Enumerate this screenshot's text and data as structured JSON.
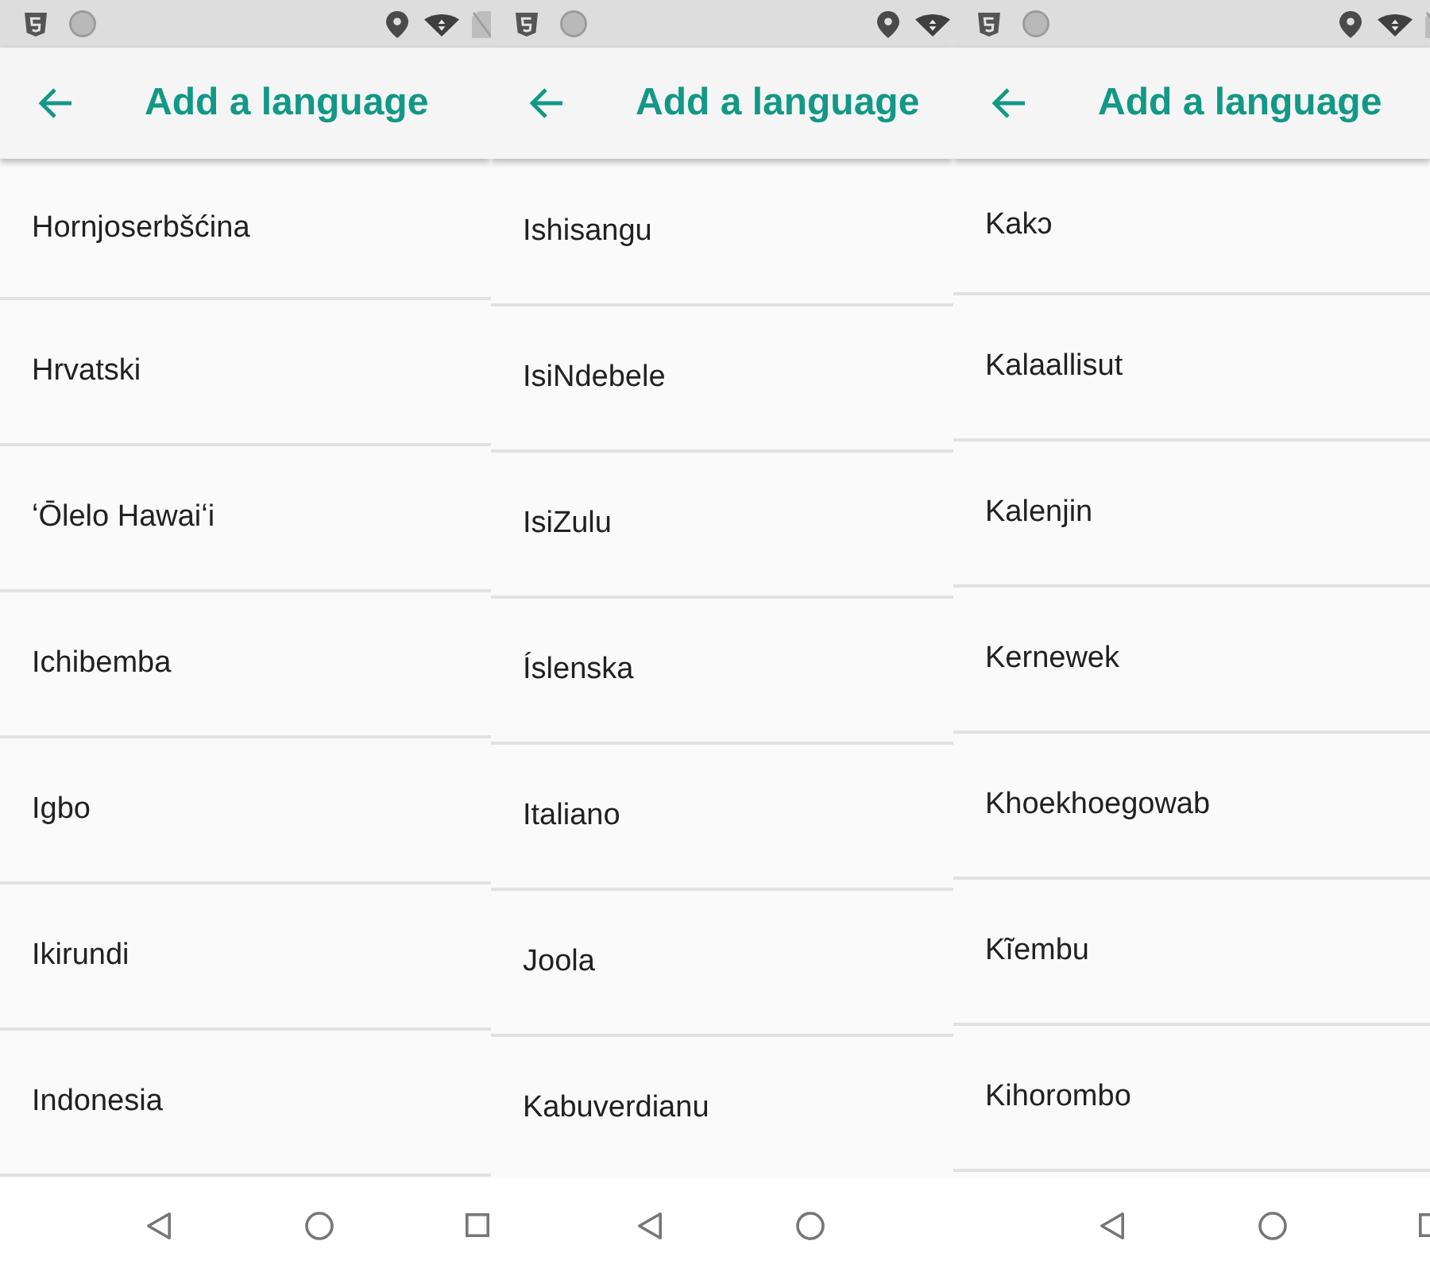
{
  "screens": [
    {
      "title": "Add a language",
      "languages": [
        "Hornjoserbšćina",
        "Hrvatski",
        "ʻŌlelo Hawaiʻi",
        "Ichibemba",
        "Igbo",
        "Ikirundi",
        "Indonesia"
      ]
    },
    {
      "title": "Add a language",
      "languages": [
        "Ishisangu",
        "IsiNdebele",
        "IsiZulu",
        "Íslenska",
        "Italiano",
        "Joola",
        "Kabuverdianu"
      ]
    },
    {
      "title": "Add a language",
      "languages": [
        "Kakɔ",
        "Kalaallisut",
        "Kalenjin",
        "Kernewek",
        "Khoekhoegowab",
        "Kĩembu",
        "Kihorombo"
      ]
    }
  ]
}
